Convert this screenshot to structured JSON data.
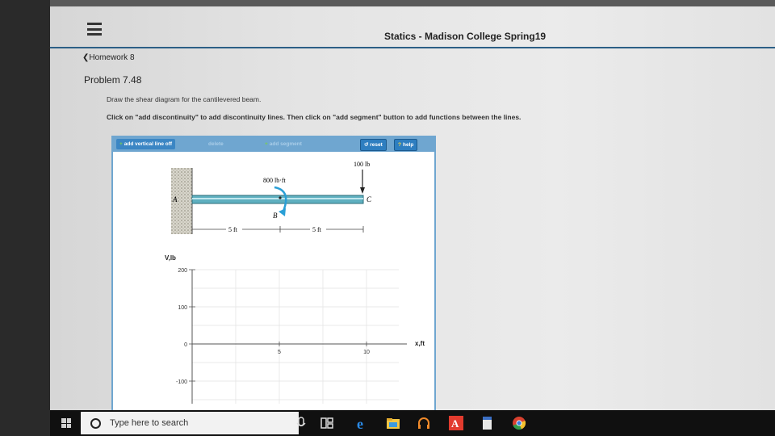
{
  "header": {
    "course_title": "Statics - Madison College Spring19"
  },
  "nav": {
    "back_label": "Homework 8"
  },
  "problem": {
    "title": "Problem 7.48",
    "instruction_1": "Draw the shear diagram for the cantilevered beam.",
    "instruction_2": "Click on \"add discontinuity\" to add discontinuity lines. Then click on \"add segment\" button to add functions between the lines."
  },
  "toolbar": {
    "add_vertical_line": "add vertical line off",
    "delete": "delete",
    "add_segment": "add segment",
    "reset": "reset",
    "help": "help"
  },
  "beam": {
    "load_point": "100 lb",
    "moment": "800 lb·ft",
    "point_a": "A",
    "point_b": "B",
    "point_c": "C",
    "dim_left": "5 ft",
    "dim_right": "5 ft"
  },
  "chart_data": {
    "type": "line",
    "ylabel": "V,lb",
    "xlabel": "x,ft",
    "x_ticks": [
      "5",
      "10"
    ],
    "y_ticks": [
      "200",
      "100",
      "0",
      "-100"
    ],
    "series": []
  },
  "taskbar": {
    "search_placeholder": "Type here to search",
    "icons": [
      "mic-icon",
      "task-view-icon",
      "edge-icon",
      "file-explorer-icon",
      "headphones-icon",
      "adobe-icon",
      "document-icon",
      "chrome-icon"
    ]
  },
  "colors": {
    "accent": "#6fa6d0",
    "beam": "#5fb0c0",
    "moment_arrow": "#2a9fd6"
  }
}
